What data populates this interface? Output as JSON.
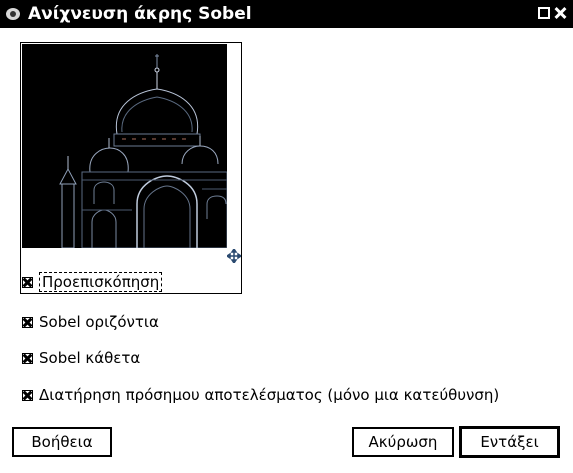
{
  "window": {
    "title": "Ανίχνευση άκρης Sobel"
  },
  "preview": {
    "label": "Προεπισκόπηση",
    "checked": true
  },
  "options": [
    {
      "label": "Sobel οριζόντια",
      "checked": true
    },
    {
      "label": "Sobel κάθετα",
      "checked": true
    },
    {
      "label": "Διατήρηση πρόσημου αποτελέσματος (μόνο μια κατεύθυνση)",
      "checked": true
    }
  ],
  "buttons": {
    "help": "Βοήθεια",
    "cancel": "Ακύρωση",
    "ok": "Εντάξει"
  },
  "icons": {
    "app": "gimp-icon",
    "maximize": "maximize-icon",
    "close": "close-icon",
    "move": "move-icon"
  }
}
